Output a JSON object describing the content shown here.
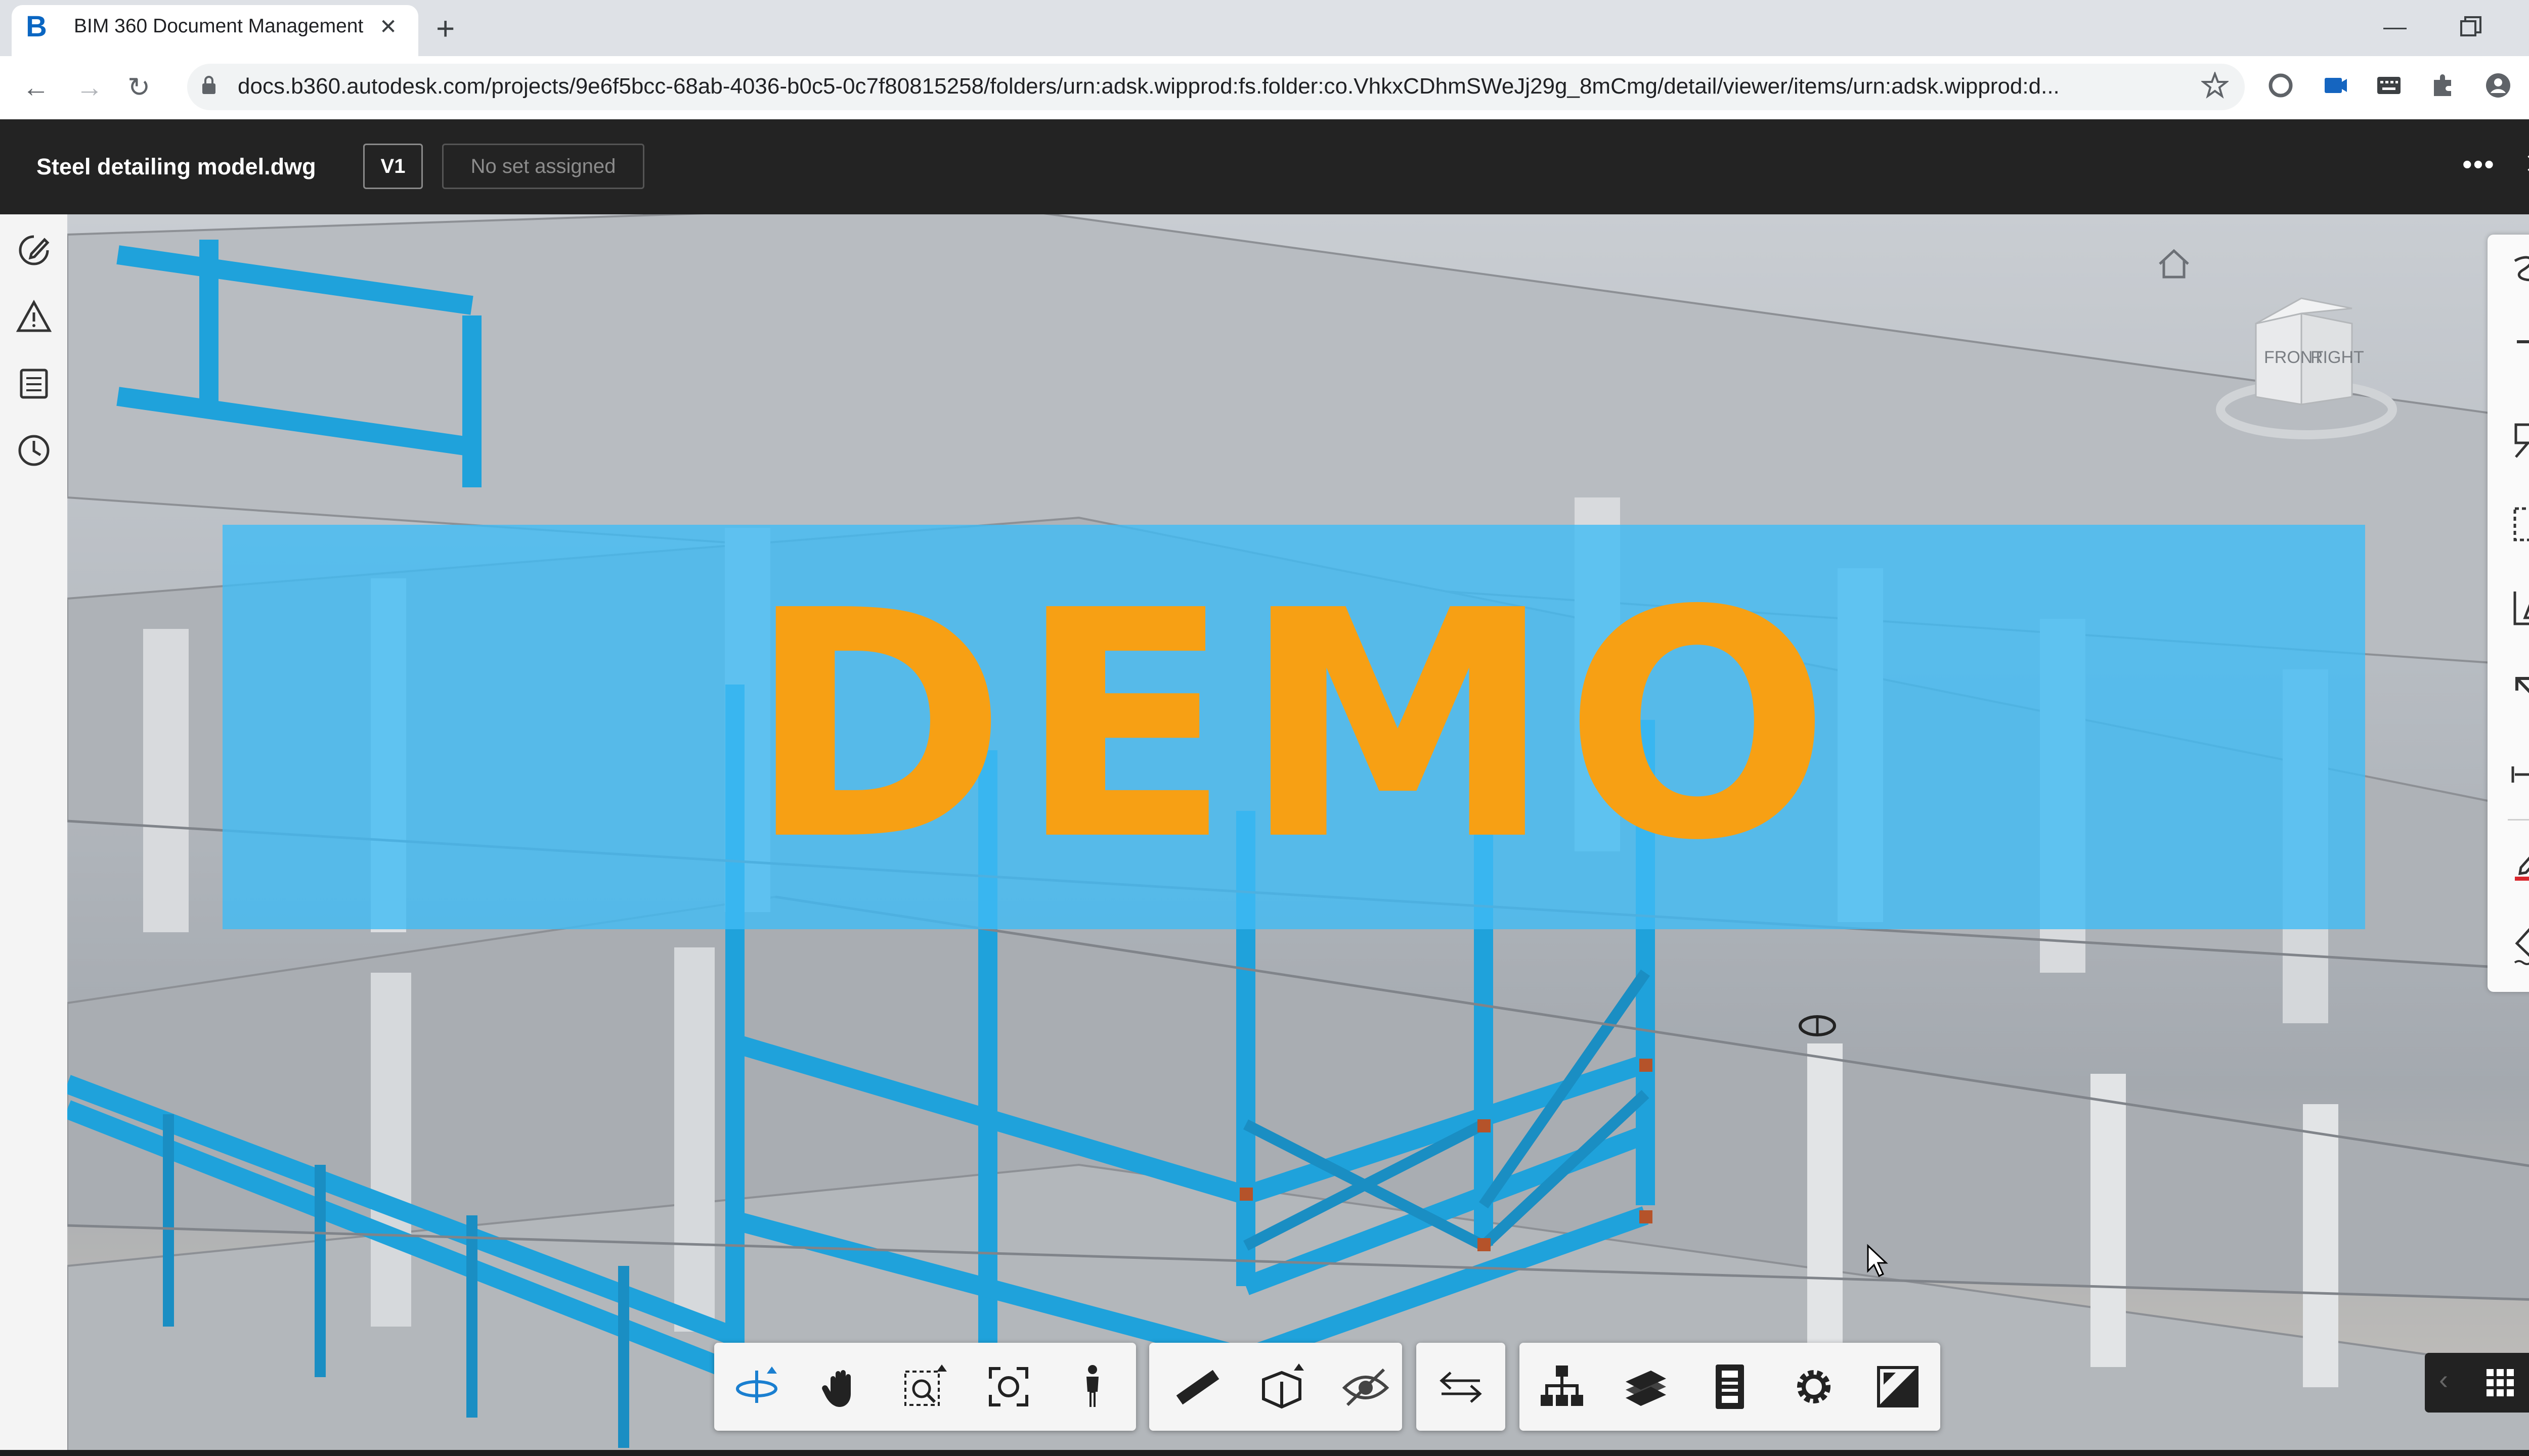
{
  "browser": {
    "tab_title": "BIM 360 Document Management",
    "tab_logo_letter": "B",
    "url": "docs.b360.autodesk.com/projects/9e6f5bcc-68ab-4036-b0c5-0c7f80815258/folders/urn:adsk.wipprod:fs.folder:co.VhkxCDhmSWeJj29g_8mCmg/detail/viewer/items/urn:adsk.wipprod:d..."
  },
  "header": {
    "document_title": "Steel detailing model.dwg",
    "version_label": "V1",
    "set_label": "No set assigned"
  },
  "viewer": {
    "watermark_text": "DEMO",
    "viewcube_faces": [
      "FRONT",
      "RIGHT"
    ]
  },
  "colors": {
    "steel_blue": "#1fa2db",
    "watermark_orange": "#f7a014",
    "banner_blue": "#40bcf5",
    "header_bg": "#232323",
    "markup_red": "#d9262c"
  },
  "icons": {
    "left_rail": [
      "markup-pen-icon",
      "issues-warning-icon",
      "document-list-icon",
      "history-clock-icon"
    ],
    "right_toolbar": [
      "freehand-draw-icon",
      "text-icon",
      "callout-icon",
      "cloud-rectangle-icon",
      "polygon-icon",
      "arrow-icon",
      "dimension-icon",
      "pen-color-icon",
      "fill-icon"
    ],
    "bottom_toolbar": [
      "orbit-icon",
      "pan-icon",
      "zoom-window-icon",
      "fit-to-view-icon",
      "first-person-icon",
      "measure-icon",
      "section-icon",
      "explode-icon",
      "compare-icon",
      "model-browser-icon",
      "layers-icon",
      "properties-icon",
      "settings-icon",
      "fullscreen-icon"
    ]
  }
}
